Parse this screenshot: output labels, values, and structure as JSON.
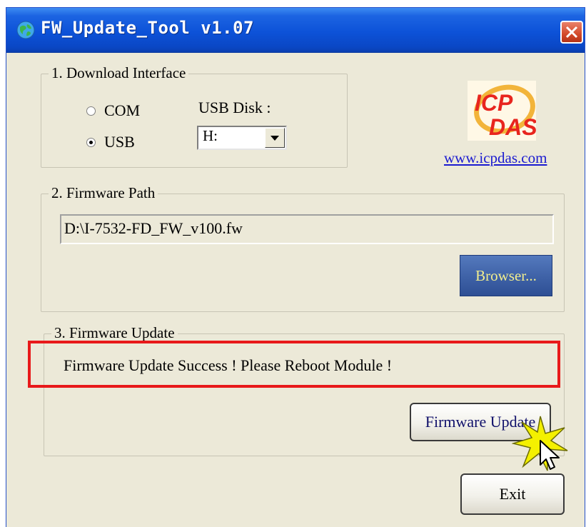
{
  "window": {
    "title": "FW_Update_Tool v1.07"
  },
  "download_interface": {
    "legend": "1. Download Interface",
    "radio_com": "COM",
    "radio_usb": "USB",
    "selected": "USB",
    "usb_disk_label": "USB Disk :",
    "usb_disk_value": "H:"
  },
  "logo": {
    "text_top": "ICP",
    "text_bottom": "DAS",
    "link": "www.icpdas.com"
  },
  "firmware_path": {
    "legend": "2. Firmware Path",
    "path": "D:\\I-7532-FD_FW_v100.fw",
    "browse_label": "Browser..."
  },
  "firmware_update": {
    "legend": "3. Firmware Update",
    "status": "Firmware Update Success !  Please Reboot Module !",
    "update_label": "Firmware Update"
  },
  "exit_label": "Exit",
  "colors": {
    "highlight": "#e8191a",
    "titlebar": "#0d52d8",
    "window_bg": "#ece9d8",
    "browse_button": "#3c5fa4"
  }
}
